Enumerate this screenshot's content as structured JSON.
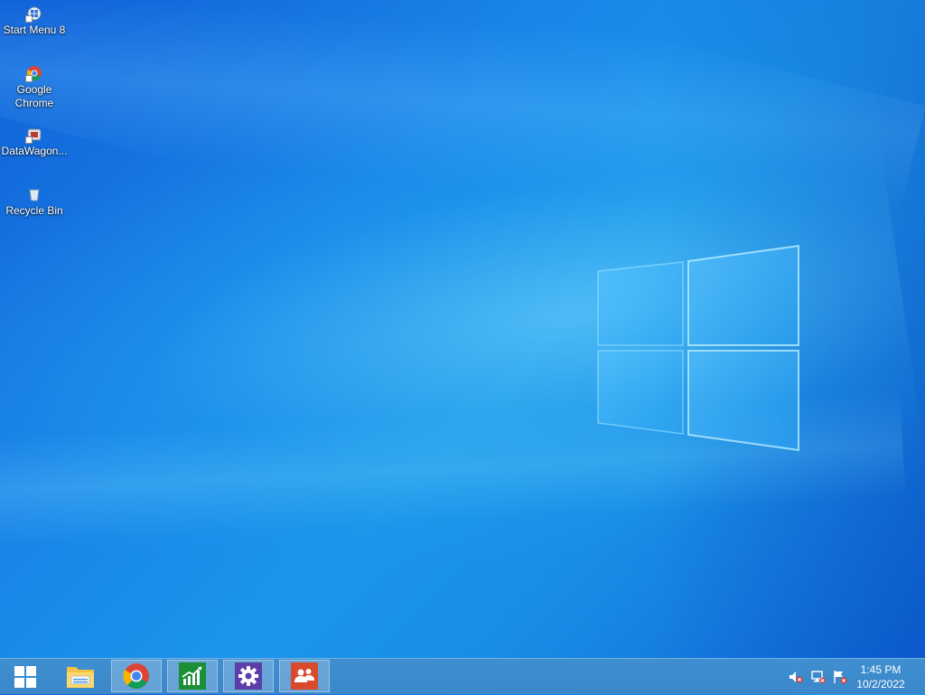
{
  "desktop": {
    "icons": [
      {
        "label": "Start Menu 8",
        "icon": "start-menu-8-icon"
      },
      {
        "label": "Google\nChrome",
        "icon": "chrome-icon"
      },
      {
        "label": "DataWagon...",
        "icon": "datawagon-icon"
      },
      {
        "label": "Recycle Bin",
        "icon": "recycle-bin-icon"
      }
    ]
  },
  "taskbar": {
    "start_icon": "windows-start-icon",
    "pinned": [
      {
        "name": "file-explorer",
        "icon": "folder-icon"
      },
      {
        "name": "google-chrome",
        "icon": "chrome-icon"
      },
      {
        "name": "finance-app",
        "icon": "chart-icon"
      },
      {
        "name": "settings",
        "icon": "gear-icon"
      },
      {
        "name": "people",
        "icon": "people-icon"
      }
    ],
    "tray": [
      {
        "icon": "speaker-muted-icon"
      },
      {
        "icon": "network-disconnected-icon"
      },
      {
        "icon": "action-center-flag-icon"
      }
    ],
    "clock": {
      "time": "1:45 PM",
      "date": "10/2/2022"
    }
  },
  "colors": {
    "taskbar": "#3a87c9",
    "desktop_accent": "#1a8ee6"
  }
}
